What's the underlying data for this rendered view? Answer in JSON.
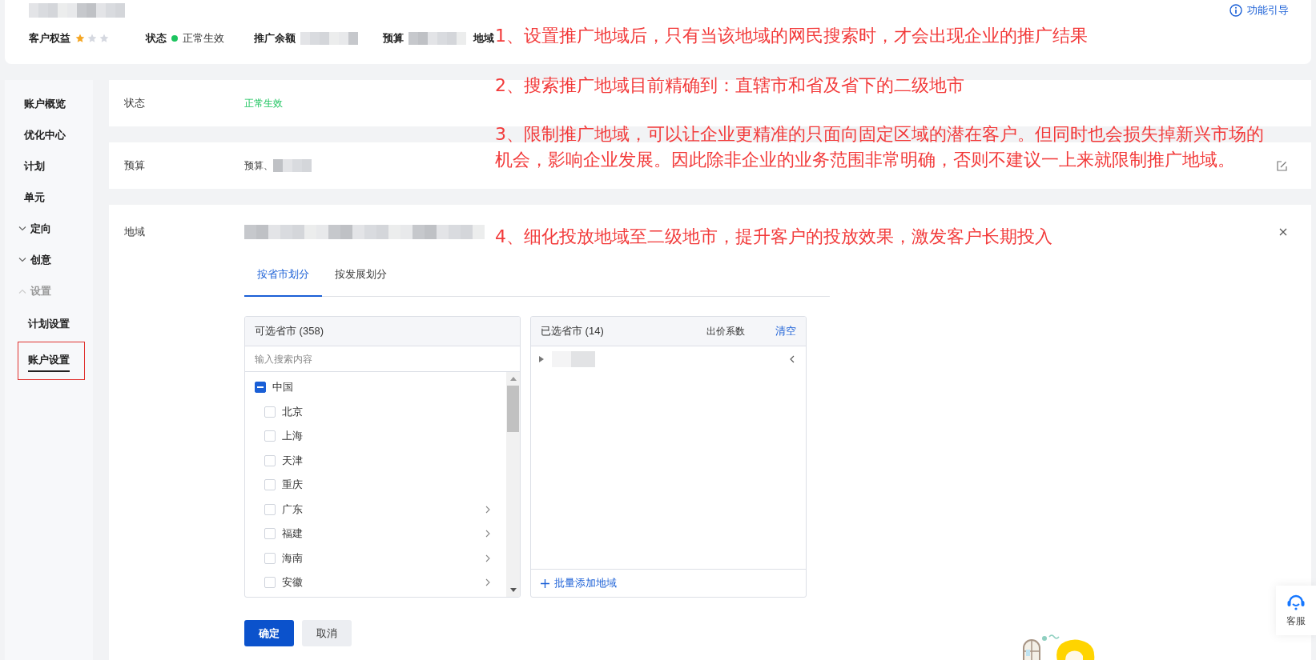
{
  "header": {
    "guide_link": "功能引导",
    "rights": {
      "label": "客户权益",
      "stars": 1
    },
    "fields": [
      {
        "label": "状态",
        "kind": "status",
        "value": "正常生效",
        "color": "#1dc45f"
      },
      {
        "label": "推广余额",
        "kind": "blurred"
      },
      {
        "label": "预算",
        "kind": "blurred"
      },
      {
        "label": "地域",
        "kind": "covered"
      }
    ]
  },
  "sidebar": {
    "items": [
      {
        "label": "账户概览",
        "selected": false
      },
      {
        "label": "优化中心",
        "selected": false
      },
      {
        "label": "计划",
        "selected": false
      },
      {
        "label": "单元",
        "selected": false
      },
      {
        "label": "定向",
        "expanded": false,
        "selected": false
      },
      {
        "label": "创意",
        "expanded": false,
        "selected": false
      },
      {
        "label": "设置",
        "expanded": true,
        "selected": false,
        "children": [
          {
            "label": "计划设置",
            "selected": false,
            "highlighted": false
          },
          {
            "label": "账户设置",
            "selected": true,
            "highlighted": true
          }
        ]
      }
    ]
  },
  "settings": [
    {
      "label": "状态",
      "kind": "status",
      "value": "正常生效"
    },
    {
      "label": "预算",
      "kind": "budget",
      "value": "预算、"
    }
  ],
  "region": {
    "label": "地域",
    "tabs": [
      {
        "label": "按省市划分",
        "selected": true
      },
      {
        "label": "按发展划分",
        "selected": false
      }
    ],
    "available": {
      "title": "可选省市 (358)",
      "placeholder": "输入搜索内容",
      "tree": [
        {
          "label": "中国",
          "indeterminate": true,
          "children": [
            {
              "label": "北京",
              "checked": false,
              "expandable": false
            },
            {
              "label": "上海",
              "checked": false,
              "expandable": false
            },
            {
              "label": "天津",
              "checked": false,
              "expandable": false
            },
            {
              "label": "重庆",
              "checked": false,
              "expandable": false
            },
            {
              "label": "广东",
              "checked": false,
              "expandable": true
            },
            {
              "label": "福建",
              "checked": false,
              "expandable": true
            },
            {
              "label": "海南",
              "checked": false,
              "expandable": true
            },
            {
              "label": "安徽",
              "checked": false,
              "expandable": true
            }
          ]
        }
      ]
    },
    "chosen": {
      "title": "已选省市 (14)",
      "column": "出价系数",
      "clear": "清空",
      "add": "批量添加地域"
    }
  },
  "buttons": [
    {
      "label": "确定",
      "kind": "primary"
    },
    {
      "label": "取消",
      "kind": "default"
    }
  ],
  "service": {
    "label": "客服"
  },
  "annotations": [
    "1、设置推广地域后，只有当该地域的网民搜索时，才会出现企业的推广结果",
    "2、搜索推广地域目前精确到：直辖市和省及省下的二级地市",
    "3、限制推广地域，可以让企业更精准的只面向固定区域的潜在客户。但同时也会损失掉新兴市场的机会，影响企业发展。因此除非企业的业务范围非常明确，否则不建议一上来就限制推广地域。",
    "4、细化投放地域至二级地市，提升客户的投放效果，激发客户长期投入"
  ]
}
